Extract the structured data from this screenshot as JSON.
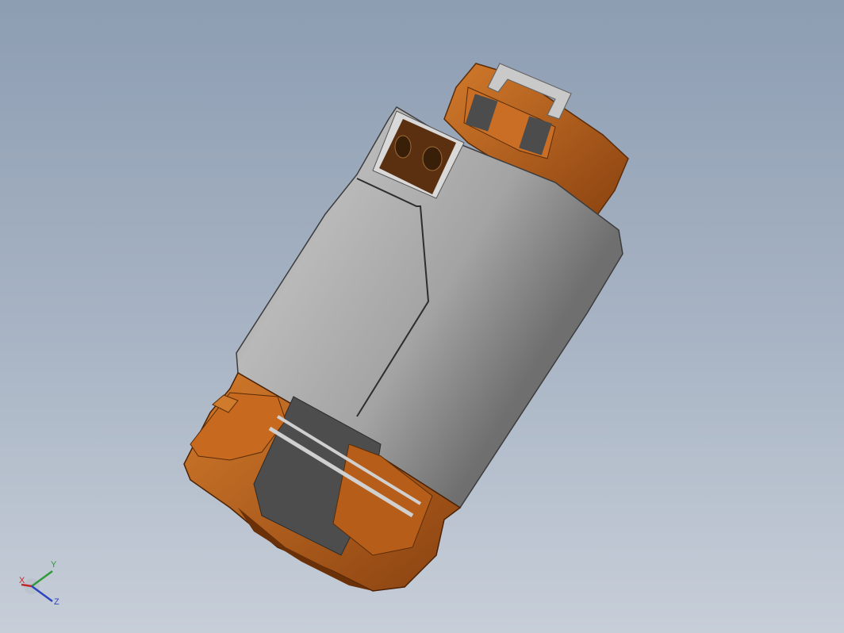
{
  "viewport": {
    "background_top": "#8d9db2",
    "background_bottom": "#c7ced8"
  },
  "model": {
    "body_color": "#a8a8a8",
    "plastic_color": "#b8621a",
    "metal_tab_color": "#c9c9c9",
    "dark_color": "#4a4a4a"
  },
  "triad": {
    "x_label": "X",
    "y_label": "Y",
    "z_label": "Z",
    "x_color": "#c0282b",
    "y_color": "#2e9a3a",
    "z_color": "#2f44c0"
  }
}
